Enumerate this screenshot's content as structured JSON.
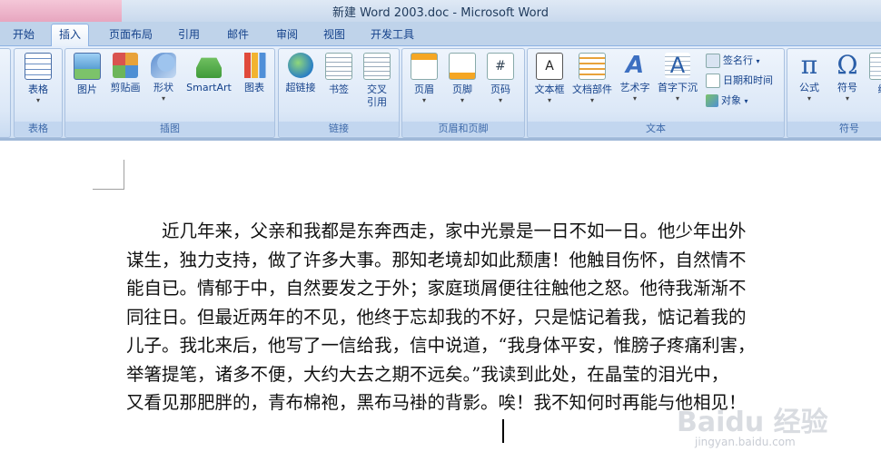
{
  "window": {
    "title": "新建 Word 2003.doc - Microsoft Word"
  },
  "tabs": [
    "开始",
    "插入",
    "页面布局",
    "引用",
    "邮件",
    "审阅",
    "视图",
    "开发工具"
  ],
  "active_tab": "插入",
  "groups": {
    "table": {
      "label": "表格",
      "buttons": [
        "表格"
      ]
    },
    "illustrations": {
      "label": "插图",
      "buttons": [
        "图片",
        "剪贴画",
        "形状",
        "SmartArt",
        "图表"
      ]
    },
    "links": {
      "label": "链接",
      "buttons": [
        "超链接",
        "书签",
        "交叉\n引用"
      ]
    },
    "header_footer": {
      "label": "页眉和页脚",
      "buttons": [
        "页眉",
        "页脚",
        "页码"
      ]
    },
    "text": {
      "label": "文本",
      "buttons": [
        "文本框",
        "文档部件",
        "艺术字",
        "首字下沉"
      ],
      "small": [
        "签名行",
        "日期和时间",
        "对象"
      ]
    },
    "symbols": {
      "label": "符号",
      "buttons": [
        "公式",
        "符号",
        "编"
      ]
    }
  },
  "document": {
    "lines": [
      "　　近几年来，父亲和我都是东奔西走，家中光景是一日不如一日。他少年出外",
      "谋生，独力支持，做了许多大事。那知老境却如此颓唐！他触目伤怀，自然情不",
      "能自已。情郁于中，自然要发之于外；家庭琐屑便往往触他之怒。他待我渐渐不",
      "同往日。但最近两年的不见，他终于忘却我的不好，只是惦记着我，惦记着我的",
      "儿子。我北来后，他写了一信给我，信中说道，“我身体平安，惟膀子疼痛利害，",
      "举箸提笔，诸多不便，大约大去之期不远矣。”我读到此处，在晶莹的泪光中，",
      "又看见那肥胖的，青布棉袍，黑布马褂的背影。唉！我不知何时再能与他相见！"
    ]
  },
  "watermark": {
    "text": "Baidu 经验",
    "url": "jingyan.baidu.com"
  }
}
